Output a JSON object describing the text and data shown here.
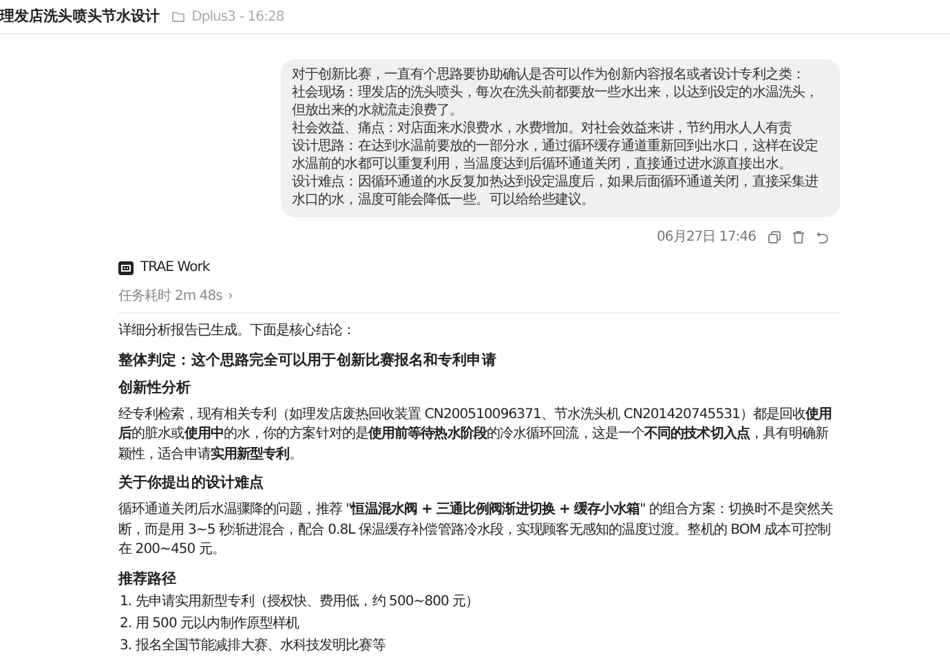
{
  "header": {
    "title": "理发店洗头喷头节水设计",
    "project": "Dplus3 - 16:28"
  },
  "user_message": {
    "paragraphs": [
      "对于创新比赛，一直有个思路要协助确认是否可以作为创新内容报名或者设计专利之类：",
      "社会现场：理发店的洗头喷头，每次在洗头前都要放一些水出来，以达到设定的水温洗头，但放出来的水就流走浪费了。",
      "社会效益、痛点：对店面来水浪费水，水费增加。对社会效益来讲，节约用水人人有责",
      "设计思路：在达到水温前要放的一部分水，通过循环缓存通道重新回到出水口，这样在设定水温前的水都可以重复利用，当温度达到后循环通道关闭，直接通过进水源直接出水。",
      "设计难点：因循环通道的水反复加热达到设定温度后，如果后面循环通道关闭，直接采集进水口的水，温度可能会降低一些。可以给给些建议。"
    ],
    "time": "06月27日 17:46"
  },
  "agent": {
    "name": "TRAE Work",
    "duration": "任务耗时 2m 48s",
    "duration_caret": "›"
  },
  "answer": [
    {
      "kind": "paragraph",
      "text": "详细分析报告已生成。下面是核心结论："
    },
    {
      "kind": "heading",
      "text": "整体判定：这个思路完全可以用于创新比赛报名和专利申请"
    },
    {
      "kind": "heading",
      "text": "创新性分析"
    },
    {
      "kind": "paragraph",
      "text": "经专利检索，现有相关专利（如理发店废热回收装置 CN200510096371、节水洗头机 CN201420745531）都是回收**使用后**的脏水或**使用中**的水，你的方案针对的是**使用前等待热水阶段**的冷水循环回流，这是一个**不同的技术切入点**，具有明确新颖性，适合申请**实用新型专利**。"
    },
    {
      "kind": "heading",
      "text": "关于你提出的设计难点"
    },
    {
      "kind": "paragraph",
      "text": "循环通道关闭后水温骤降的问题，推荐 \"**恒温混水阀 + 三通比例阀渐进切换 + 缓存小水箱**\" 的组合方案：切换时不是突然关断，而是用 3~5 秒渐进混合，配合 0.8L 保温缓存补偿管路冷水段，实现顾客无感知的温度过渡。整机的 BOM 成本可控制在 200~450 元。"
    },
    {
      "kind": "heading",
      "text": "推荐路径"
    },
    {
      "kind": "list",
      "items": [
        "1. 先申请实用新型专利（授权快、费用低，约 500~800 元）",
        "2. 用 500 元以内制作原型样机",
        "3. 报名全国节能减排大赛、水科技发明比赛等"
      ]
    }
  ]
}
